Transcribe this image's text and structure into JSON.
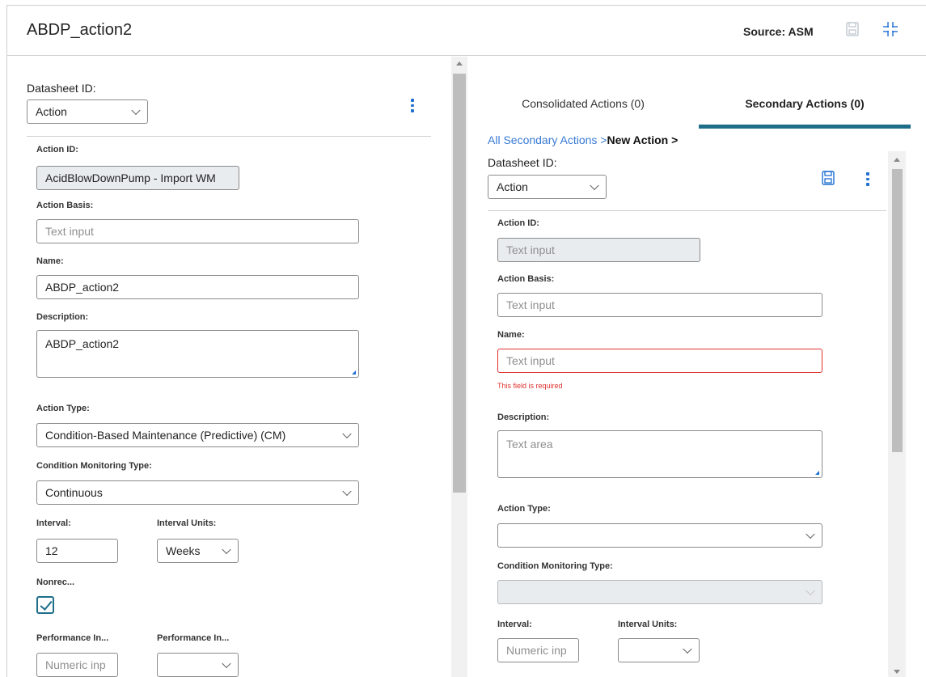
{
  "header": {
    "title": "ABDP_action2",
    "source_label": "Source: ASM",
    "icons": [
      "save-icon",
      "collapse-icon"
    ]
  },
  "left": {
    "datasheet_label": "Datasheet ID:",
    "datasheet_value": "Action",
    "action_id_label": "Action ID:",
    "action_id_value": "AcidBlowDownPump - Import WM",
    "action_basis_label": "Action Basis:",
    "action_basis_placeholder": "Text input",
    "name_label": "Name:",
    "name_value": "ABDP_action2",
    "description_label": "Description:",
    "description_value": "ABDP_action2",
    "action_type_label": "Action Type:",
    "action_type_value": "Condition-Based Maintenance (Predictive) (CM)",
    "cm_type_label": "Condition Monitoring Type:",
    "cm_type_value": "Continuous",
    "interval_label": "Interval:",
    "interval_value": "12",
    "interval_units_label": "Interval Units:",
    "interval_units_value": "Weeks",
    "nonrec_label": "Nonrec...",
    "nonrec_checked": true,
    "perf1_label": "Performance In...",
    "perf1_placeholder": "Numeric inp",
    "perf2_label": "Performance In..."
  },
  "right": {
    "tabs": [
      {
        "label": "Consolidated Actions (0)",
        "active": false
      },
      {
        "label": "Secondary Actions (0)",
        "active": true
      }
    ],
    "breadcrumb_link": "All Secondary Actions >",
    "breadcrumb_current": "New Action >",
    "datasheet_label": "Datasheet ID:",
    "datasheet_value": "Action",
    "action_id_label": "Action ID:",
    "action_id_placeholder": "Text input",
    "action_basis_label": "Action Basis:",
    "action_basis_placeholder": "Text input",
    "name_label": "Name:",
    "name_placeholder": "Text input",
    "name_error": "This field is required",
    "description_label": "Description:",
    "description_placeholder": "Text area",
    "action_type_label": "Action Type:",
    "cm_type_label": "Condition Monitoring Type:",
    "interval_label": "Interval:",
    "interval_placeholder": "Numeric inp",
    "interval_units_label": "Interval Units:"
  },
  "colors": {
    "accent": "#1e6e8a",
    "link": "#3a7bd5",
    "icon_blue": "#1f6fd1",
    "error": "#e0322f"
  }
}
